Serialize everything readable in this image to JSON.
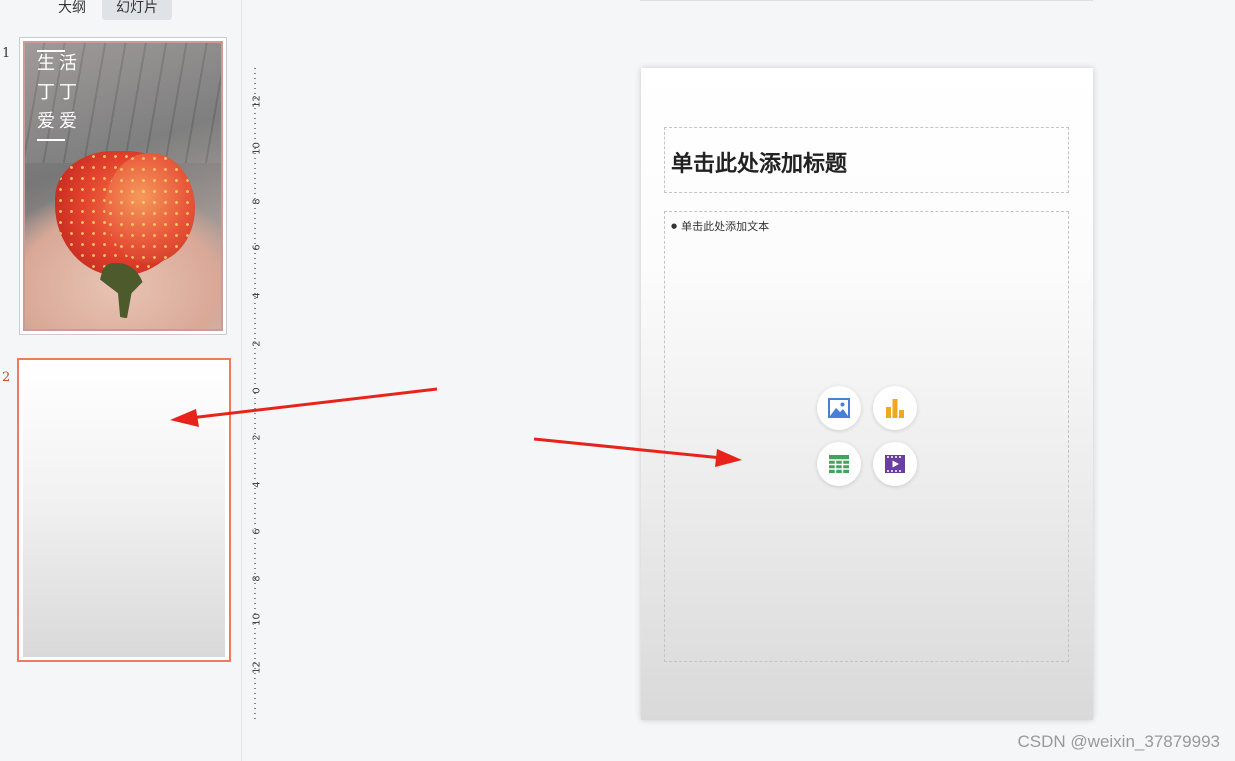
{
  "tabs": {
    "outline": "大纲",
    "slides": "幻灯片"
  },
  "thumbnails": [
    {
      "number": "1",
      "text_lines": [
        "生活",
        "丁丁",
        "爱爱"
      ]
    },
    {
      "number": "2"
    }
  ],
  "ruler": {
    "labels": [
      "12",
      "10",
      "8",
      "6",
      "4",
      "2",
      "0",
      "2",
      "4",
      "6",
      "8",
      "10",
      "12"
    ]
  },
  "slide": {
    "title_placeholder": "单击此处添加标题",
    "body_placeholder": "单击此处添加文本",
    "insert_icons": [
      "insert-picture-icon",
      "insert-chart-icon",
      "insert-table-icon",
      "insert-video-icon"
    ]
  },
  "colors": {
    "accent": "#f07a5d",
    "arrow": "#e8231b",
    "icon_picture": "#4a7fd9",
    "icon_chart": "#f0a81c",
    "icon_table": "#3ea55a",
    "icon_video": "#6b3fa0"
  },
  "watermark": "CSDN @weixin_37879993"
}
